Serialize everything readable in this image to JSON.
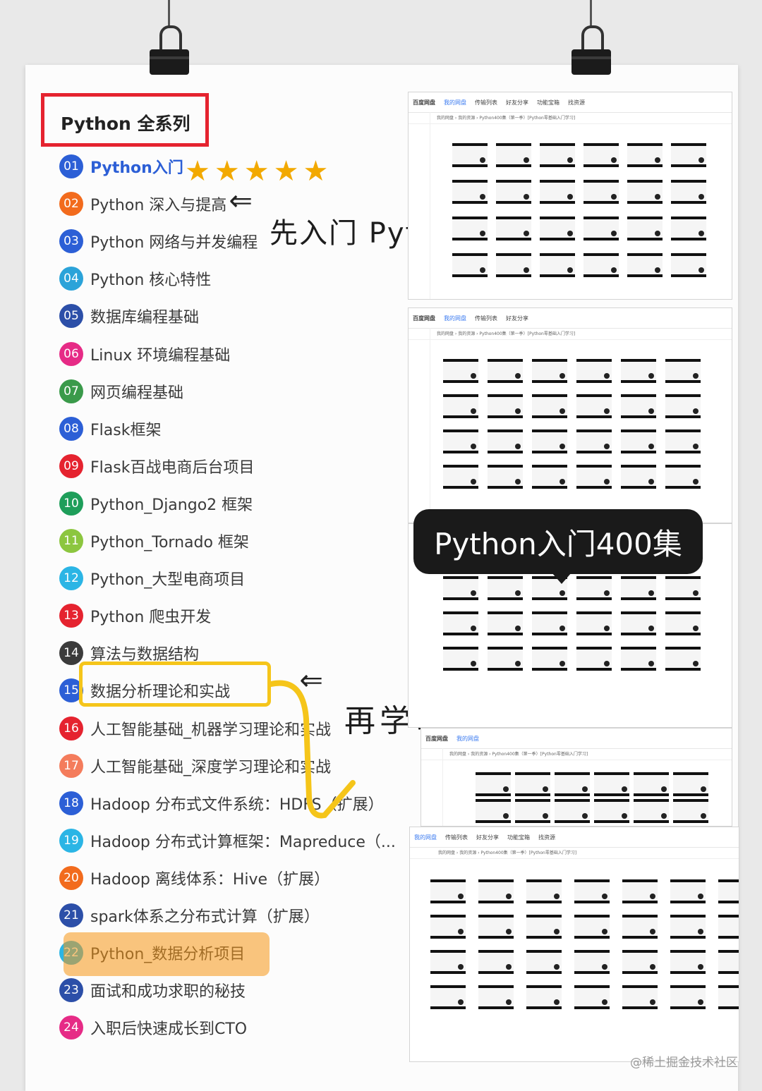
{
  "title": "Python 全系列",
  "items": [
    {
      "num": "01",
      "label": "Python入门",
      "color": "#2c5fd6"
    },
    {
      "num": "02",
      "label": "Python 深入与提高",
      "color": "#f26b1d"
    },
    {
      "num": "03",
      "label": "Python 网络与并发编程",
      "color": "#2c5fd6"
    },
    {
      "num": "04",
      "label": "Python 核心特性",
      "color": "#2ba3d9"
    },
    {
      "num": "05",
      "label": "数据库编程基础",
      "color": "#2c4fa8"
    },
    {
      "num": "06",
      "label": "Linux 环境编程基础",
      "color": "#e62b86"
    },
    {
      "num": "07",
      "label": "网页编程基础",
      "color": "#3a9a4a"
    },
    {
      "num": "08",
      "label": "Flask框架",
      "color": "#2c5fd6"
    },
    {
      "num": "09",
      "label": "Flask百战电商后台项目",
      "color": "#e5232f"
    },
    {
      "num": "10",
      "label": "Python_Django2 框架",
      "color": "#1e9e5a"
    },
    {
      "num": "11",
      "label": "Python_Tornado 框架",
      "color": "#8cc63f"
    },
    {
      "num": "12",
      "label": "Python_大型电商项目",
      "color": "#2bb5e5"
    },
    {
      "num": "13",
      "label": "Python 爬虫开发",
      "color": "#e5232f"
    },
    {
      "num": "14",
      "label": "算法与数据结构",
      "color": "#3b3b3b"
    },
    {
      "num": "15",
      "label": "数据分析理论和实战",
      "color": "#2c5fd6"
    },
    {
      "num": "16",
      "label": "人工智能基础_机器学习理论和实战",
      "color": "#e5232f"
    },
    {
      "num": "17",
      "label": "人工智能基础_深度学习理论和实战",
      "color": "#f47c5c"
    },
    {
      "num": "18",
      "label": "Hadoop 分布式文件系统：HDFS（扩展）",
      "color": "#2c5fd6"
    },
    {
      "num": "19",
      "label": "Hadoop 分布式计算框架：Mapreduce（...",
      "color": "#2bb5e5"
    },
    {
      "num": "20",
      "label": "Hadoop 离线体系：Hive（扩展）",
      "color": "#f26b1d"
    },
    {
      "num": "21",
      "label": "spark体系之分布式计算（扩展）",
      "color": "#2c4fa8"
    },
    {
      "num": "22",
      "label": "Python_数据分析项目",
      "color": "#2bb5e5"
    },
    {
      "num": "23",
      "label": "面试和成功求职的秘技",
      "color": "#2c4fa8"
    },
    {
      "num": "24",
      "label": "入职后快速成长到CTO",
      "color": "#e62b86"
    }
  ],
  "stars": "★★★★★",
  "note1": "先入门 Python再说",
  "note2": "再学习数据分析",
  "bubble": "Python入门400集",
  "shot": {
    "brand": "百度网盘",
    "tabs": [
      "我的网盘",
      "传输列表",
      "好友分享",
      "功能宝箱",
      "找资源"
    ],
    "path": "我的网盘 › 我的资源 › Python400集（第一季）[Python零基础入门学习]"
  },
  "watermark": "@稀土掘金技术社区",
  "icons": {
    "arrow": "arrow-cursor-icon",
    "play": "play-icon",
    "folder": "folder-icon"
  }
}
